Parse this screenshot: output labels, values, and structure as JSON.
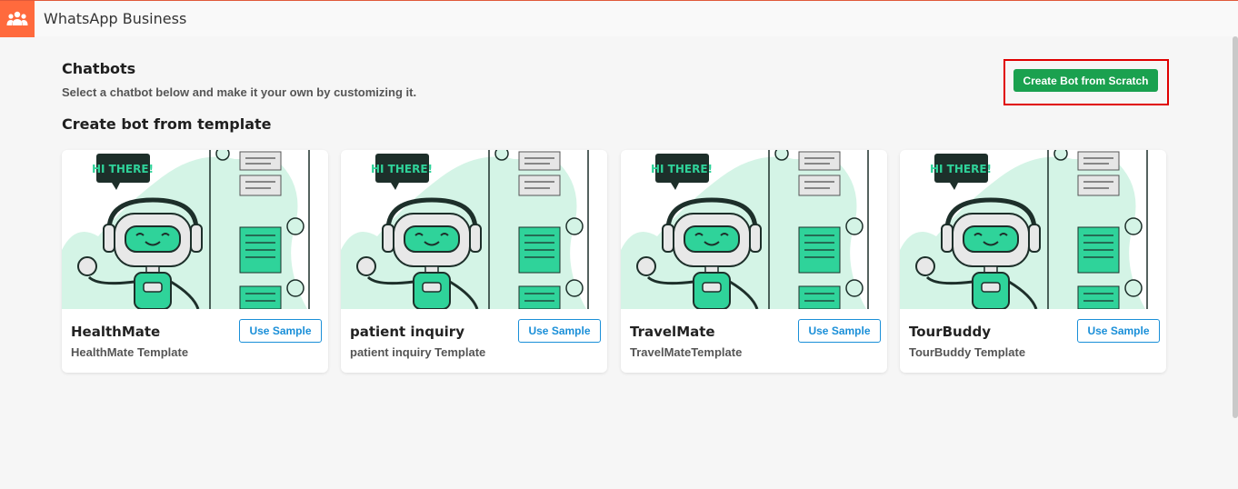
{
  "header": {
    "app_title": "WhatsApp Business",
    "logo_icon": "users-group-icon",
    "logo_color": "#ff6a3d"
  },
  "page": {
    "title": "Chatbots",
    "subtitle": "Select a chatbot below and make it your own by customizing it.",
    "section_title": "Create bot from template",
    "create_button_label": "Create Bot from Scratch",
    "accent_green": "#1aa14f",
    "accent_blue": "#1a8fd8"
  },
  "templates": [
    {
      "name": "HealthMate",
      "description": "HealthMate Template",
      "button_label": "Use Sample",
      "illustration_text": "HI THERE!"
    },
    {
      "name": "patient inquiry",
      "description": "patient inquiry Template",
      "button_label": "Use Sample",
      "illustration_text": "HI THERE!"
    },
    {
      "name": "TravelMate",
      "description": "TravelMateTemplate",
      "button_label": "Use Sample",
      "illustration_text": "HI THERE!"
    },
    {
      "name": "TourBuddy",
      "description": "TourBuddy Template",
      "button_label": "Use Sample",
      "illustration_text": "HI THERE!"
    }
  ]
}
